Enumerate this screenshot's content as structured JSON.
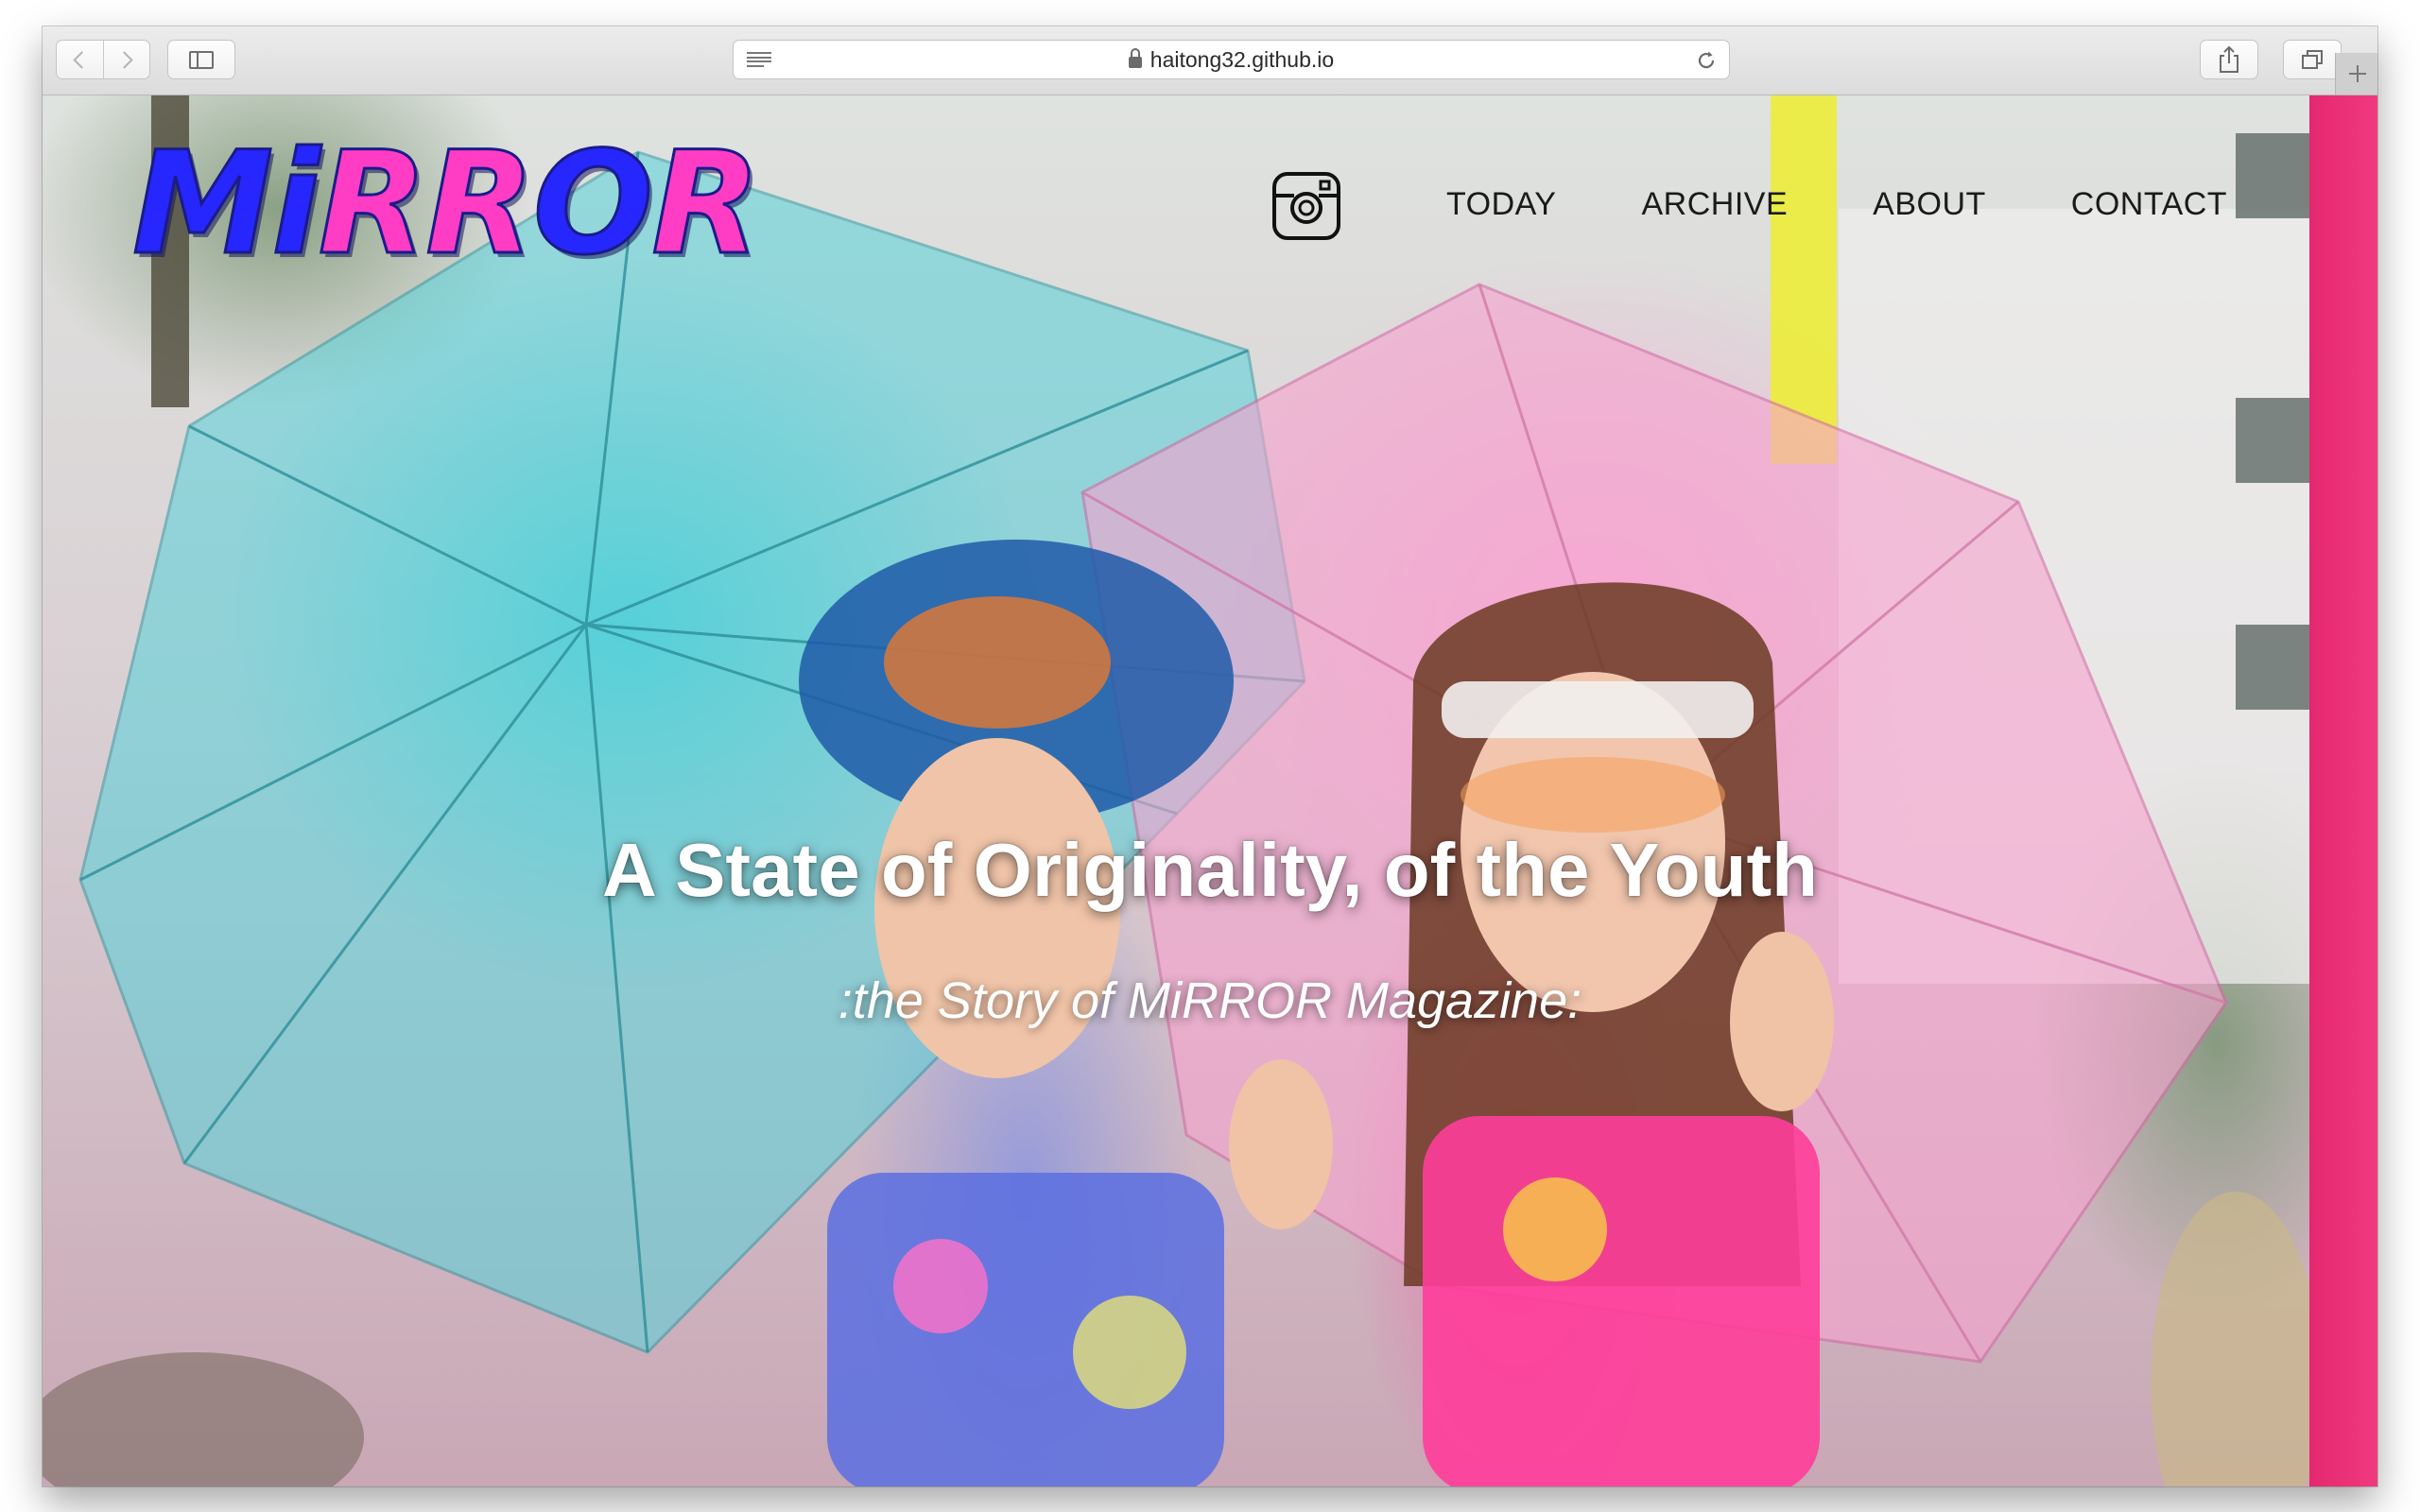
{
  "browser": {
    "url": "haitong32.github.io",
    "icons": {
      "back": "chevron-left-icon",
      "forward": "chevron-right-icon",
      "sidebar": "sidebar-icon",
      "reader": "reader-icon",
      "lock": "lock-icon",
      "reload": "reload-icon",
      "share": "share-icon",
      "tabs": "tabs-icon",
      "new_tab": "plus-icon"
    }
  },
  "site": {
    "logo": {
      "letters": [
        {
          "char": "M",
          "color": "#2626ff"
        },
        {
          "char": "i",
          "color": "#2626ff"
        },
        {
          "char": "R",
          "color": "#ff3cc4"
        },
        {
          "char": "R",
          "color": "#ff3cc4"
        },
        {
          "char": "O",
          "color": "#2626ff"
        },
        {
          "char": "R",
          "color": "#ff3cc4"
        }
      ]
    },
    "instagram_icon": "instagram-icon",
    "nav": [
      {
        "label": "TODAY"
      },
      {
        "label": "ARCHIVE"
      },
      {
        "label": "ABOUT"
      },
      {
        "label": "CONTACT"
      }
    ],
    "hero": {
      "title": "A State of Originality, of the Youth",
      "subtitle": ":the Story of MiRROR Magazine:"
    },
    "colors": {
      "accent_pink": "#f03a80",
      "logo_blue": "#2626ff",
      "logo_pink": "#ff3cc4"
    }
  }
}
